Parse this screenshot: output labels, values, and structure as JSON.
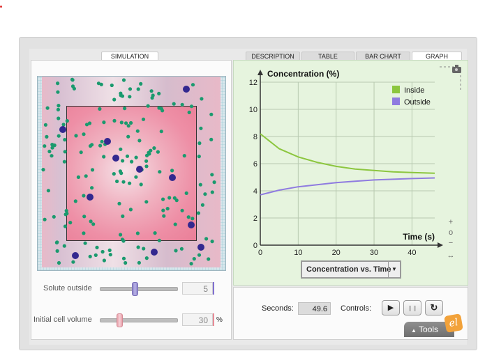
{
  "tabs": {
    "simulation": "SIMULATION",
    "description": "DESCRIPTION",
    "table": "TABLE",
    "bar_chart": "BAR CHART",
    "graph": "GRAPH"
  },
  "simulation": {
    "large_particles": 11,
    "small_particles": 180
  },
  "sliders": {
    "solute_outside": {
      "label": "Solute outside",
      "value": "5",
      "accent": "#7f6fd0"
    },
    "initial_cell_volume": {
      "label": "Initial cell volume",
      "value": "30",
      "unit": "%",
      "accent": "#e88a96"
    }
  },
  "graph": {
    "dropdown_label": "Concentration vs. Time",
    "zoom_in": "+",
    "zoom_reset": "o",
    "zoom_out": "−",
    "expand": "↔"
  },
  "chart_data": {
    "type": "line",
    "title": "",
    "xlabel": "Time (s)",
    "ylabel": "Concentration (%)",
    "xlim": [
      0,
      46
    ],
    "ylim": [
      0,
      12
    ],
    "xticks": [
      0,
      10,
      20,
      30,
      40
    ],
    "yticks": [
      0,
      2,
      4,
      6,
      8,
      10,
      12
    ],
    "grid": true,
    "legend_position": "top-right",
    "series": [
      {
        "name": "Inside",
        "color": "#8cc63f",
        "x": [
          0,
          5,
          10,
          15,
          20,
          25,
          30,
          35,
          40,
          46
        ],
        "y": [
          8.2,
          7.1,
          6.5,
          6.1,
          5.8,
          5.6,
          5.5,
          5.4,
          5.35,
          5.3
        ]
      },
      {
        "name": "Outside",
        "color": "#8f7be0",
        "x": [
          0,
          5,
          10,
          15,
          20,
          25,
          30,
          35,
          40,
          46
        ],
        "y": [
          3.7,
          4.05,
          4.3,
          4.45,
          4.6,
          4.7,
          4.8,
          4.85,
          4.9,
          4.95
        ]
      }
    ]
  },
  "controls": {
    "seconds_label": "Seconds:",
    "seconds_value": "49.6",
    "controls_label": "Controls:",
    "play_icon": "▶",
    "pause_icon": "❚❚",
    "reset_icon": "↻",
    "tools_label": "Tools",
    "tools_icon": "▲",
    "logo_text": "el"
  },
  "colors": {
    "small_particle": "#1a9a6e",
    "large_particle": "#33288f"
  }
}
